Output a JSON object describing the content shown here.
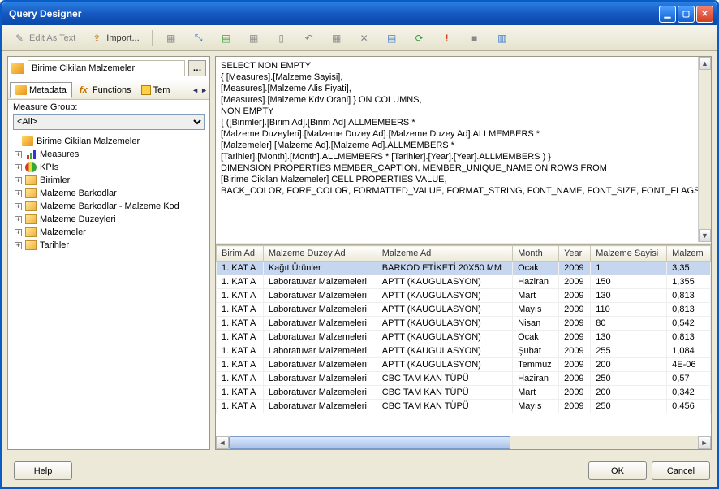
{
  "window": {
    "title": "Query Designer"
  },
  "toolbar": {
    "edit_as_text": "Edit As Text",
    "import": "Import..."
  },
  "left": {
    "cube_name": "Birime Cikilan Malzemeler",
    "tabs": {
      "metadata": "Metadata",
      "functions": "Functions",
      "templates": "Tem"
    },
    "measure_group_label": "Measure Group:",
    "measure_group_value": "<All>",
    "tree": {
      "root": "Birime Cikilan Malzemeler",
      "items": [
        {
          "label": "Measures",
          "icon": "measures"
        },
        {
          "label": "KPIs",
          "icon": "kpi"
        },
        {
          "label": "Birimler",
          "icon": "dim"
        },
        {
          "label": "Malzeme Barkodlar",
          "icon": "dim"
        },
        {
          "label": "Malzeme Barkodlar - Malzeme Kod",
          "icon": "dim"
        },
        {
          "label": "Malzeme Duzeyleri",
          "icon": "dim"
        },
        {
          "label": "Malzemeler",
          "icon": "dim"
        },
        {
          "label": "Tarihler",
          "icon": "dim"
        }
      ]
    }
  },
  "sql": {
    "lines": [
      "SELECT NON EMPTY",
      "{ [Measures].[Malzeme Sayisi],",
      "[Measures].[Malzeme Alis Fiyati],",
      "[Measures].[Malzeme Kdv Orani] } ON COLUMNS,",
      "NON EMPTY",
      "{ ([Birimler].[Birim Ad].[Birim Ad].ALLMEMBERS *",
      "[Malzeme Duzeyleri].[Malzeme Duzey Ad].[Malzeme Duzey Ad].ALLMEMBERS *",
      "[Malzemeler].[Malzeme Ad].[Malzeme Ad].ALLMEMBERS *",
      "[Tarihler].[Month].[Month].ALLMEMBERS * [Tarihler].[Year].[Year].ALLMEMBERS ) }",
      "DIMENSION PROPERTIES MEMBER_CAPTION, MEMBER_UNIQUE_NAME ON ROWS FROM",
      "[Birime Cikilan Malzemeler] CELL PROPERTIES VALUE,",
      "BACK_COLOR, FORE_COLOR, FORMATTED_VALUE, FORMAT_STRING, FONT_NAME, FONT_SIZE, FONT_FLAGS"
    ]
  },
  "grid": {
    "columns": [
      "Birim Ad",
      "Malzeme Duzey Ad",
      "Malzeme Ad",
      "Month",
      "Year",
      "Malzeme Sayisi",
      "Malzem"
    ],
    "rows": [
      {
        "sel": true,
        "c": [
          "1. KAT A",
          "Kağıt Ürünler",
          "BARKOD ETİKETİ 20X50 MM",
          "Ocak",
          "2009",
          "1",
          "3,35"
        ]
      },
      {
        "sel": false,
        "c": [
          "1. KAT A",
          "Laboratuvar Malzemeleri",
          "APTT (KAUGULASYON)",
          "Haziran",
          "2009",
          "150",
          "1,355"
        ]
      },
      {
        "sel": false,
        "c": [
          "1. KAT A",
          "Laboratuvar Malzemeleri",
          "APTT (KAUGULASYON)",
          "Mart",
          "2009",
          "130",
          "0,813"
        ]
      },
      {
        "sel": false,
        "c": [
          "1. KAT A",
          "Laboratuvar Malzemeleri",
          "APTT (KAUGULASYON)",
          "Mayıs",
          "2009",
          "110",
          "0,813"
        ]
      },
      {
        "sel": false,
        "c": [
          "1. KAT A",
          "Laboratuvar Malzemeleri",
          "APTT (KAUGULASYON)",
          "Nisan",
          "2009",
          "80",
          "0,542"
        ]
      },
      {
        "sel": false,
        "c": [
          "1. KAT A",
          "Laboratuvar Malzemeleri",
          "APTT (KAUGULASYON)",
          "Ocak",
          "2009",
          "130",
          "0,813"
        ]
      },
      {
        "sel": false,
        "c": [
          "1. KAT A",
          "Laboratuvar Malzemeleri",
          "APTT (KAUGULASYON)",
          "Şubat",
          "2009",
          "255",
          "1,084"
        ]
      },
      {
        "sel": false,
        "c": [
          "1. KAT A",
          "Laboratuvar Malzemeleri",
          "APTT (KAUGULASYON)",
          "Temmuz",
          "2009",
          "200",
          "4E-06"
        ]
      },
      {
        "sel": false,
        "c": [
          "1. KAT A",
          "Laboratuvar Malzemeleri",
          "CBC TAM KAN TÜPÜ",
          "Haziran",
          "2009",
          "250",
          "0,57"
        ]
      },
      {
        "sel": false,
        "c": [
          "1. KAT A",
          "Laboratuvar Malzemeleri",
          "CBC TAM KAN TÜPÜ",
          "Mart",
          "2009",
          "200",
          "0,342"
        ]
      },
      {
        "sel": false,
        "c": [
          "1. KAT A",
          "Laboratuvar Malzemeleri",
          "CBC TAM KAN TÜPÜ",
          "Mayıs",
          "2009",
          "250",
          "0,456"
        ]
      }
    ]
  },
  "buttons": {
    "help": "Help",
    "ok": "OK",
    "cancel": "Cancel"
  }
}
